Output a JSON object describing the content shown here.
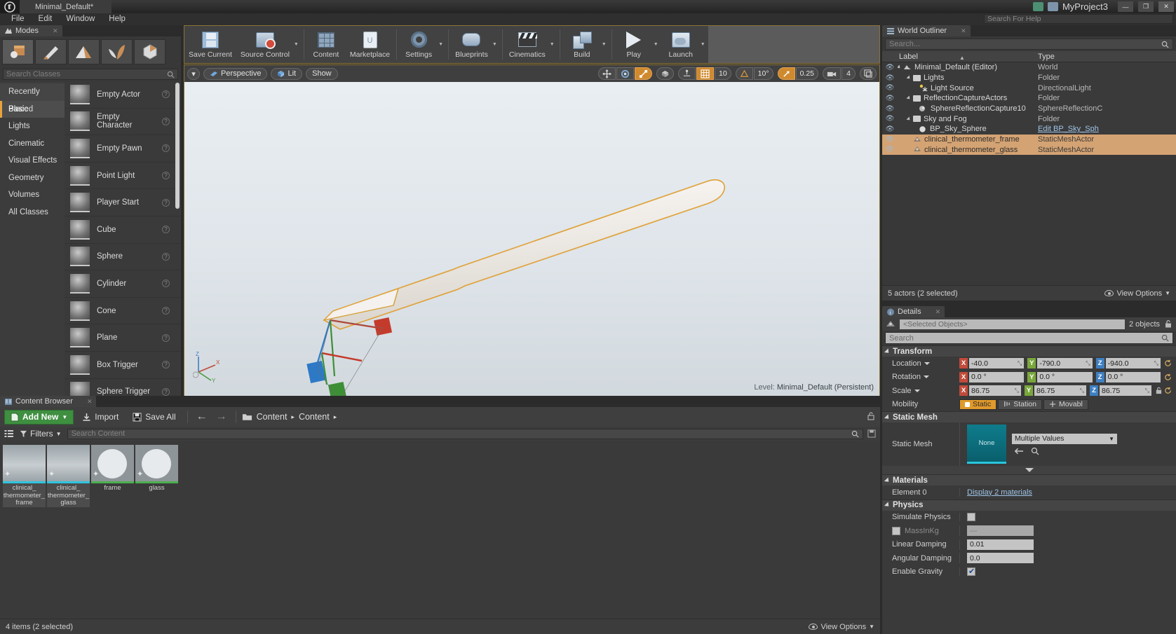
{
  "titlebar": {
    "document_tab": "Minimal_Default*",
    "project_name": "MyProject3",
    "minimize": "—",
    "maximize": "❐",
    "close": "✕"
  },
  "menubar": {
    "items": [
      "File",
      "Edit",
      "Window",
      "Help"
    ],
    "help_search_placeholder": "Search For Help"
  },
  "modes_panel": {
    "tab_label": "Modes",
    "tab_close": "✕",
    "mode_buttons": [
      "place-mode",
      "paint-mode",
      "landscape-mode",
      "foliage-mode",
      "geometry-editing-mode"
    ],
    "search_placeholder": "Search Classes",
    "categories": [
      "Recently Placed",
      "Basic",
      "Lights",
      "Cinematic",
      "Visual Effects",
      "Geometry",
      "Volumes",
      "All Classes"
    ],
    "selected_category": "Basic",
    "classes": [
      "Empty Actor",
      "Empty Character",
      "Empty Pawn",
      "Point Light",
      "Player Start",
      "Cube",
      "Sphere",
      "Cylinder",
      "Cone",
      "Plane",
      "Box Trigger",
      "Sphere Trigger"
    ]
  },
  "main_toolbar": {
    "buttons": [
      {
        "label": "Save Current",
        "icon": "floppy-disk-icon",
        "caret": false
      },
      {
        "label": "Source Control",
        "icon": "source-control-icon",
        "caret": true
      },
      {
        "label": "Content",
        "icon": "content-grid-icon",
        "caret": false
      },
      {
        "label": "Marketplace",
        "icon": "marketplace-bag-icon",
        "caret": false
      },
      {
        "label": "Settings",
        "icon": "settings-gear-icon",
        "caret": true
      },
      {
        "label": "Blueprints",
        "icon": "blueprints-icon",
        "caret": true
      },
      {
        "label": "Cinematics",
        "icon": "clapperboard-icon",
        "caret": true
      },
      {
        "label": "Build",
        "icon": "build-icon",
        "caret": true
      },
      {
        "label": "Play",
        "icon": "play-icon",
        "caret": true
      },
      {
        "label": "Launch",
        "icon": "launch-icon",
        "caret": true
      }
    ]
  },
  "viewport": {
    "dropdown_caret": "▾",
    "perspective_label": "Perspective",
    "lit_label": "Lit",
    "show_label": "Show",
    "transform_tools": [
      "translate-tool",
      "rotate-tool",
      "scale-tool"
    ],
    "active_transform_tool": "scale-tool",
    "coord_system": "world-space-icon",
    "surface_snap": "surface-snap-icon",
    "grid_snap_enabled": true,
    "grid_snap_value": "10",
    "angle_snap_value": "10°",
    "scale_snap_value": "0.25",
    "camera_speed_value": "4",
    "maximize_icon": "maximize-viewport-icon",
    "level_prefix": "Level:",
    "level_name": "Minimal_Default (Persistent)",
    "gizmo_axes": [
      "Z",
      "X",
      "Y"
    ]
  },
  "outliner": {
    "tab_label": "World Outliner",
    "tab_close": "✕",
    "search_placeholder": "Search...",
    "columns": [
      "Label",
      "Type"
    ],
    "rows": [
      {
        "label": "Minimal_Default (Editor)",
        "type": "World",
        "indent": 0,
        "icon": "world-icon",
        "expandable": true,
        "selected": false,
        "link": false
      },
      {
        "label": "Lights",
        "type": "Folder",
        "indent": 1,
        "icon": "folder-icon",
        "expandable": true,
        "selected": false,
        "link": false
      },
      {
        "label": "Light Source",
        "type": "DirectionalLight",
        "indent": 2,
        "icon": "light-icon",
        "expandable": false,
        "selected": false,
        "link": false
      },
      {
        "label": "ReflectionCaptureActors",
        "type": "Folder",
        "indent": 1,
        "icon": "folder-icon",
        "expandable": true,
        "selected": false,
        "link": false
      },
      {
        "label": "SphereReflectionCapture10",
        "type": "SphereReflectionC",
        "indent": 2,
        "icon": "reflection-icon",
        "expandable": false,
        "selected": false,
        "link": false
      },
      {
        "label": "Sky and Fog",
        "type": "Folder",
        "indent": 1,
        "icon": "folder-icon",
        "expandable": true,
        "selected": false,
        "link": false
      },
      {
        "label": "BP_Sky_Sphere",
        "type": "Edit BP_Sky_Sph",
        "indent": 2,
        "icon": "sphere-icon",
        "expandable": false,
        "selected": false,
        "link": true
      },
      {
        "label": "clinical_thermometer_frame",
        "type": "StaticMeshActor",
        "indent": 1,
        "icon": "mesh-icon",
        "expandable": false,
        "selected": true,
        "link": false
      },
      {
        "label": "clinical_thermometer_glass",
        "type": "StaticMeshActor",
        "indent": 1,
        "icon": "mesh-icon",
        "expandable": false,
        "selected": true,
        "link": false
      }
    ],
    "status_text": "5 actors (2 selected)",
    "view_options_label": "View Options"
  },
  "details": {
    "tab_label": "Details",
    "tab_close": "✕",
    "object_field_value": "<Selected Objects>",
    "object_count": "2 objects",
    "search_placeholder": "Search",
    "sections": {
      "transform": "Transform",
      "static_mesh": "Static Mesh",
      "materials": "Materials",
      "physics": "Physics"
    },
    "transform": {
      "location_label": "Location",
      "location": {
        "x": "-40.0",
        "y": "-790.0",
        "z": "-940.0"
      },
      "rotation_label": "Rotation",
      "rotation": {
        "x": "0.0 °",
        "y": "0.0 °",
        "z": "0.0 °"
      },
      "scale_label": "Scale",
      "scale": {
        "x": "86.75",
        "y": "86.75",
        "z": "86.75"
      },
      "mobility_label": "Mobility",
      "mobility_options": [
        "Static",
        "Station",
        "Movabl"
      ],
      "mobility_selected": "Static"
    },
    "static_mesh": {
      "label": "Static Mesh",
      "thumb_text": "None",
      "combo_value": "Multiple Values",
      "combo_caret": "▾"
    },
    "materials": {
      "element_label": "Element 0",
      "element_value": "Display 2 materials"
    },
    "physics": {
      "simulate_label": "Simulate Physics",
      "simulate_checked": false,
      "mass_label": "MassInKg",
      "mass_value": "---",
      "mass_override_checked": false,
      "linear_damping_label": "Linear Damping",
      "linear_damping_value": "0.01",
      "angular_damping_label": "Angular Damping",
      "angular_damping_value": "0.0",
      "enable_gravity_label": "Enable Gravity",
      "enable_gravity_checked": true
    }
  },
  "content_browser": {
    "tab_label": "Content Browser",
    "tab_close": "✕",
    "add_new_label": "Add New",
    "add_new_caret": "▾",
    "import_label": "Import",
    "save_all_label": "Save All",
    "nav_back": "←",
    "nav_forward": "→",
    "breadcrumb": [
      "Content",
      "Content"
    ],
    "breadcrumb_sep": "▸",
    "filters_label": "Filters",
    "filters_caret": "▾",
    "search_placeholder": "Search Content",
    "assets": [
      {
        "name": "clinical_\nthermometer_\nframe",
        "type_color": "#2ec4de",
        "kind": "texture",
        "selected": true
      },
      {
        "name": "clinical_\nthermometer_\nglass",
        "type_color": "#2ec4de",
        "kind": "texture",
        "selected": true
      },
      {
        "name": "frame",
        "type_color": "#4caf50",
        "kind": "material",
        "selected": false
      },
      {
        "name": "glass",
        "type_color": "#4caf50",
        "kind": "material",
        "selected": false
      }
    ],
    "status_text": "4 items (2 selected)",
    "view_options_label": "View Options"
  },
  "colors": {
    "accent_orange": "#d08a2e",
    "selection_tan": "#d4a373",
    "panel_bg": "#3a3a3a",
    "toolbar_bg": "#3f3f3f",
    "link_blue": "#9fc4e8",
    "add_new_green": "#3f8f41"
  }
}
